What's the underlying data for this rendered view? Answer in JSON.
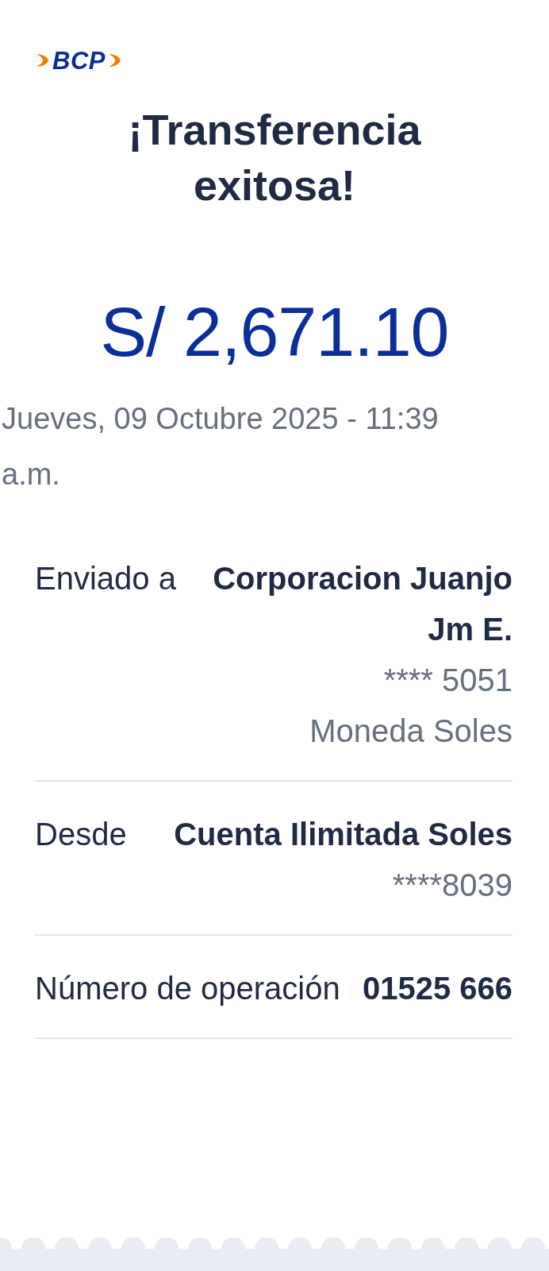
{
  "logo": {
    "text": "BCP"
  },
  "title": "¡Transferencia exitosa!",
  "amount": "S/ 2,671.10",
  "datetime": "Jueves, 09 Octubre 2025 - 11:39 a.m.",
  "details": [
    {
      "label": "Enviado a",
      "lines": [
        {
          "text": "Corporacion Juanjo Jm E.",
          "bold": true
        },
        {
          "text": "**** 5051",
          "bold": false
        },
        {
          "text": "Moneda Soles",
          "bold": false
        }
      ]
    },
    {
      "label": "Desde",
      "lines": [
        {
          "text": "Cuenta Ilimitada Soles",
          "bold": true
        },
        {
          "text": "****8039",
          "bold": false
        }
      ]
    },
    {
      "label": "Número de operación",
      "lines": [
        {
          "text": "01525 666",
          "bold": true
        }
      ]
    }
  ]
}
